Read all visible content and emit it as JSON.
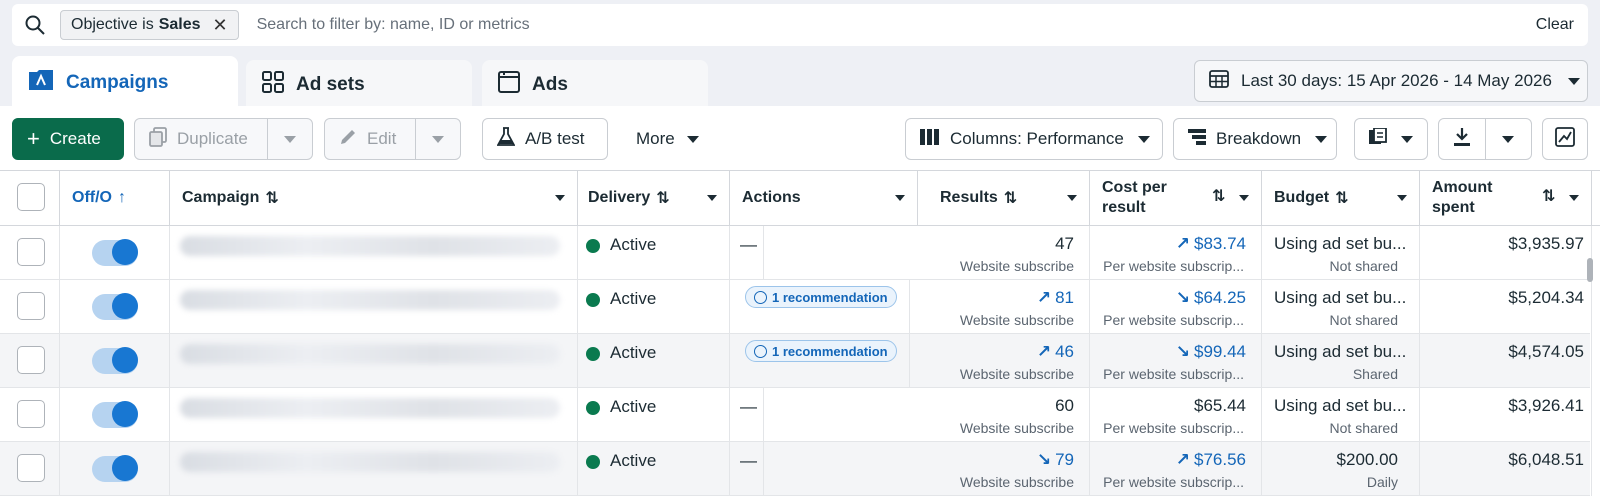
{
  "search": {
    "filter_prefix": "Objective is",
    "filter_value": "Sales",
    "placeholder": "Search to filter by: name, ID or metrics",
    "clear_label": "Clear"
  },
  "tabs": [
    {
      "label": "Campaigns",
      "icon": "campaigns-icon",
      "active": true
    },
    {
      "label": "Ad sets",
      "icon": "grid-icon"
    },
    {
      "label": "Ads",
      "icon": "ad-window-icon"
    }
  ],
  "date_range": {
    "label": "Last 30 days: 15 Apr 2026 - 14 May 2026"
  },
  "toolbar": {
    "create": "Create",
    "duplicate": "Duplicate",
    "edit": "Edit",
    "ab_test": "A/B test",
    "more": "More",
    "columns": "Columns: Performance",
    "breakdown": "Breakdown"
  },
  "columns": {
    "offon": "Off/O",
    "campaign": "Campaign",
    "delivery": "Delivery",
    "actions": "Actions",
    "results": "Results",
    "cost_line1": "Cost per",
    "cost_line2": "result",
    "budget": "Budget",
    "amount_line1": "Amount",
    "amount_line2": "spent"
  },
  "rows": [
    {
      "delivery": "Active",
      "action": "—",
      "results": "47",
      "results_trend": "",
      "results_sub": "Website subscribe",
      "cost": "$83.74",
      "cost_trend": "up",
      "cost_sub": "Per website subscrip...",
      "budget": "Using ad set bu...",
      "budget_sub": "Not shared",
      "amount": "$3,935.97"
    },
    {
      "delivery": "Active",
      "action": "1 recommendation",
      "results": "81",
      "results_trend": "up",
      "results_sub": "Website subscribe",
      "cost": "$64.25",
      "cost_trend": "down",
      "cost_sub": "Per website subscrip...",
      "budget": "Using ad set bu...",
      "budget_sub": "Not shared",
      "amount": "$5,204.34"
    },
    {
      "delivery": "Active",
      "action": "1 recommendation",
      "results": "46",
      "results_trend": "up",
      "results_sub": "Website subscribe",
      "cost": "$99.44",
      "cost_trend": "down",
      "cost_sub": "Per website subscrip...",
      "budget": "Using ad set bu...",
      "budget_sub": "Shared",
      "amount": "$4,574.05"
    },
    {
      "delivery": "Active",
      "action": "—",
      "results": "60",
      "results_trend": "",
      "results_sub": "Website subscribe",
      "cost": "$65.44",
      "cost_trend": "",
      "cost_sub": "Per website subscrip...",
      "budget": "Using ad set bu...",
      "budget_sub": "Not shared",
      "amount": "$3,926.41"
    },
    {
      "delivery": "Active",
      "action": "—",
      "results": "79",
      "results_trend": "down",
      "results_sub": "Website subscribe",
      "cost": "$76.56",
      "cost_trend": "up",
      "cost_sub": "Per website subscrip...",
      "budget": "$200.00",
      "budget_sub": "Daily",
      "amount": "$6,048.51"
    }
  ],
  "colors": {
    "accent": "#1466b8",
    "create": "#0a6b4b",
    "active_dot": "#0a7a4f"
  }
}
